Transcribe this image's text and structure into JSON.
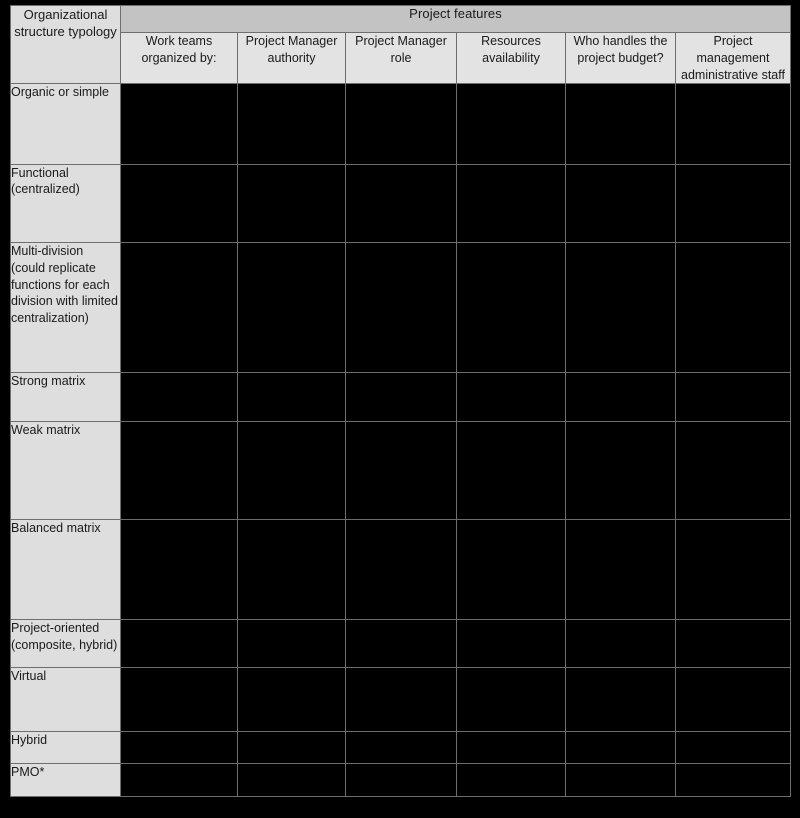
{
  "table": {
    "corner_header": "Organizational structure typology",
    "band_header": "Project features",
    "feature_columns": [
      {
        "label": "Work teams organized by:"
      },
      {
        "label": "Project Manager authority"
      },
      {
        "label": "Project Manager role"
      },
      {
        "label": "Resources availability"
      },
      {
        "label": "Who handles the project budget?"
      },
      {
        "label": "Project management administrative staff"
      }
    ],
    "rows": [
      {
        "label": "Organic or simple"
      },
      {
        "label": "Functional (centralized)"
      },
      {
        "label": "Multi-division (could replicate functions for each division with limited centralization)"
      },
      {
        "label": "Strong matrix"
      },
      {
        "label": "Weak matrix"
      },
      {
        "label": "Balanced matrix"
      },
      {
        "label": "Project-oriented (composite, hybrid)"
      },
      {
        "label": "Virtual"
      },
      {
        "label": "Hybrid"
      },
      {
        "label": "PMO*"
      }
    ],
    "colors": {
      "page_background": "#000000",
      "band_header_fill": "#c3c3c3",
      "sub_header_fill": "#e3e3e3",
      "row_header_fill": "#dedede",
      "cell_fill": "#000000",
      "grid_line": "#6e6e6e",
      "text": "#1a1a1a"
    }
  }
}
